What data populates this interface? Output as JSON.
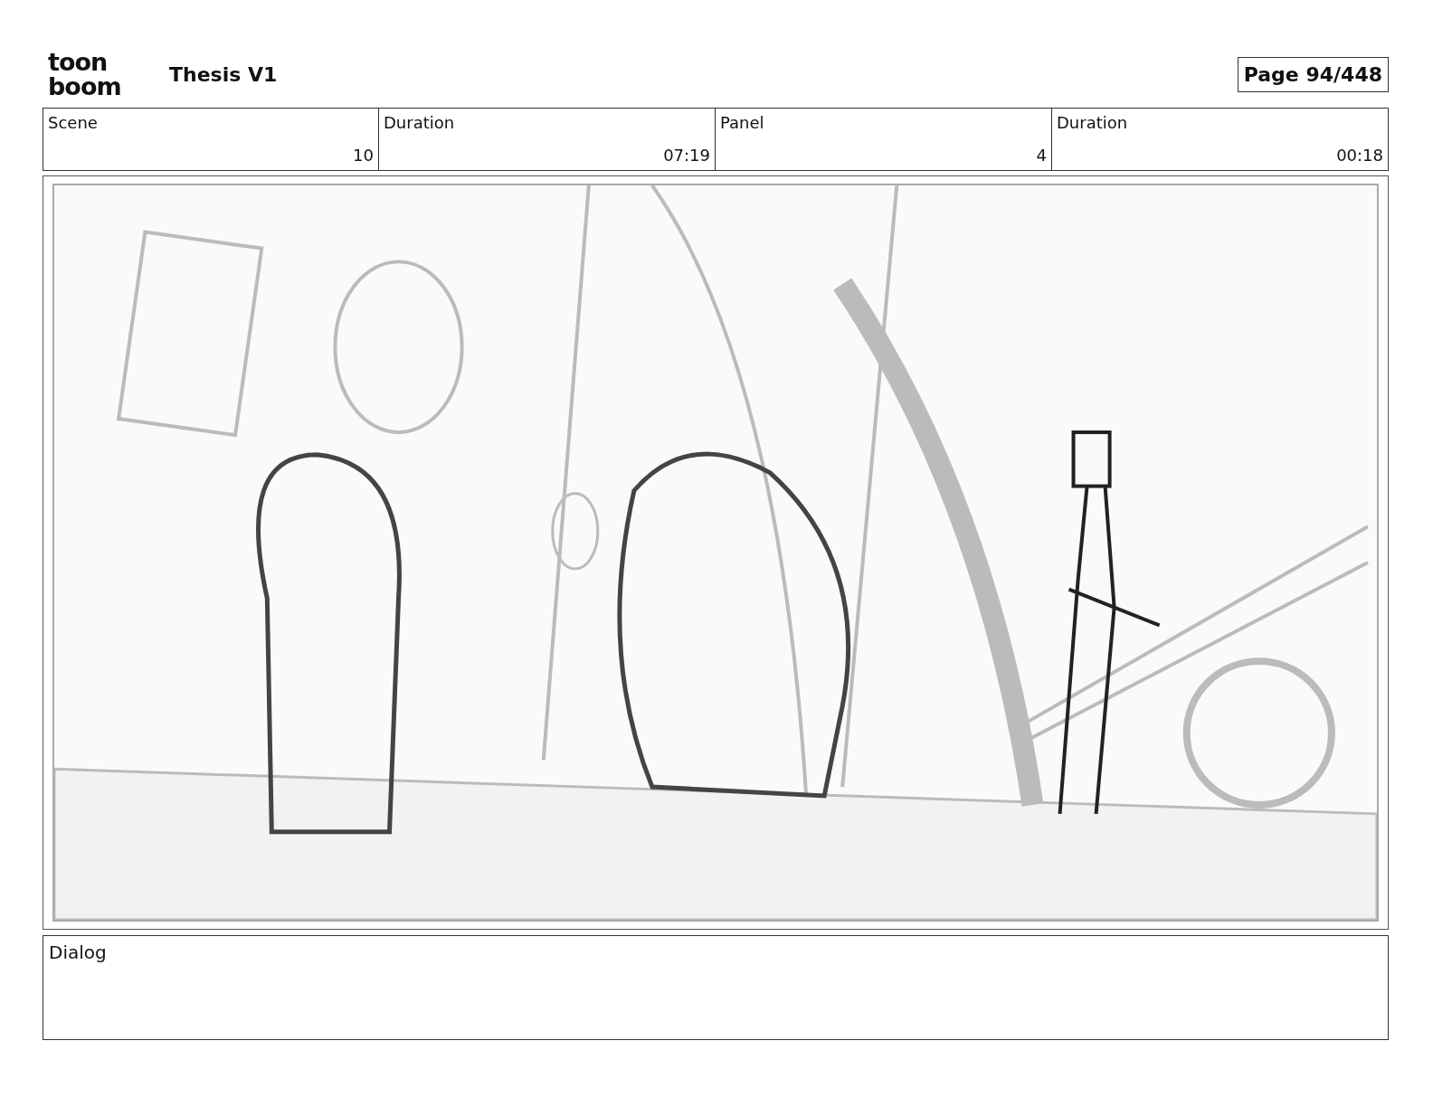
{
  "logo": {
    "top": "toon",
    "bottom": "boom"
  },
  "title": "Thesis V1",
  "page": "Page 94/448",
  "fields": [
    {
      "heading": "Scene",
      "entry": "10"
    },
    {
      "heading": "Duration",
      "entry": "07:19"
    },
    {
      "heading": "Panel",
      "entry": "4"
    },
    {
      "heading": "Duration",
      "entry": "00:18"
    }
  ],
  "dialog": {
    "label": "Dialog"
  }
}
